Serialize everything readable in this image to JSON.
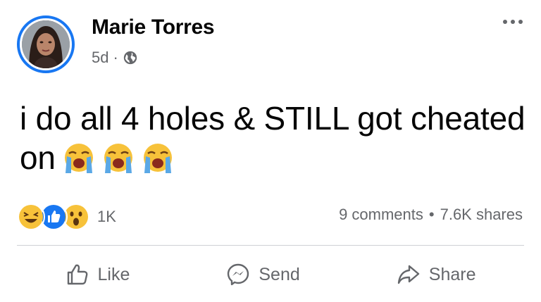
{
  "post": {
    "author": "Marie Torres",
    "time": "5d",
    "separator": "·",
    "text": "i do all 4 holes & STILL got cheated on",
    "emoji": [
      "loudly-crying-face",
      "loudly-crying-face",
      "loudly-crying-face"
    ]
  },
  "reactions": {
    "icons": [
      "haha",
      "like",
      "wow"
    ],
    "count": "1K"
  },
  "stats": {
    "comments": "9 comments",
    "dot": "•",
    "shares": "7.6K shares"
  },
  "actions": {
    "like": "Like",
    "send": "Send",
    "share": "Share"
  },
  "colors": {
    "accent": "#1877f2",
    "secondary_text": "#65676b",
    "divider": "#ced0d4"
  }
}
